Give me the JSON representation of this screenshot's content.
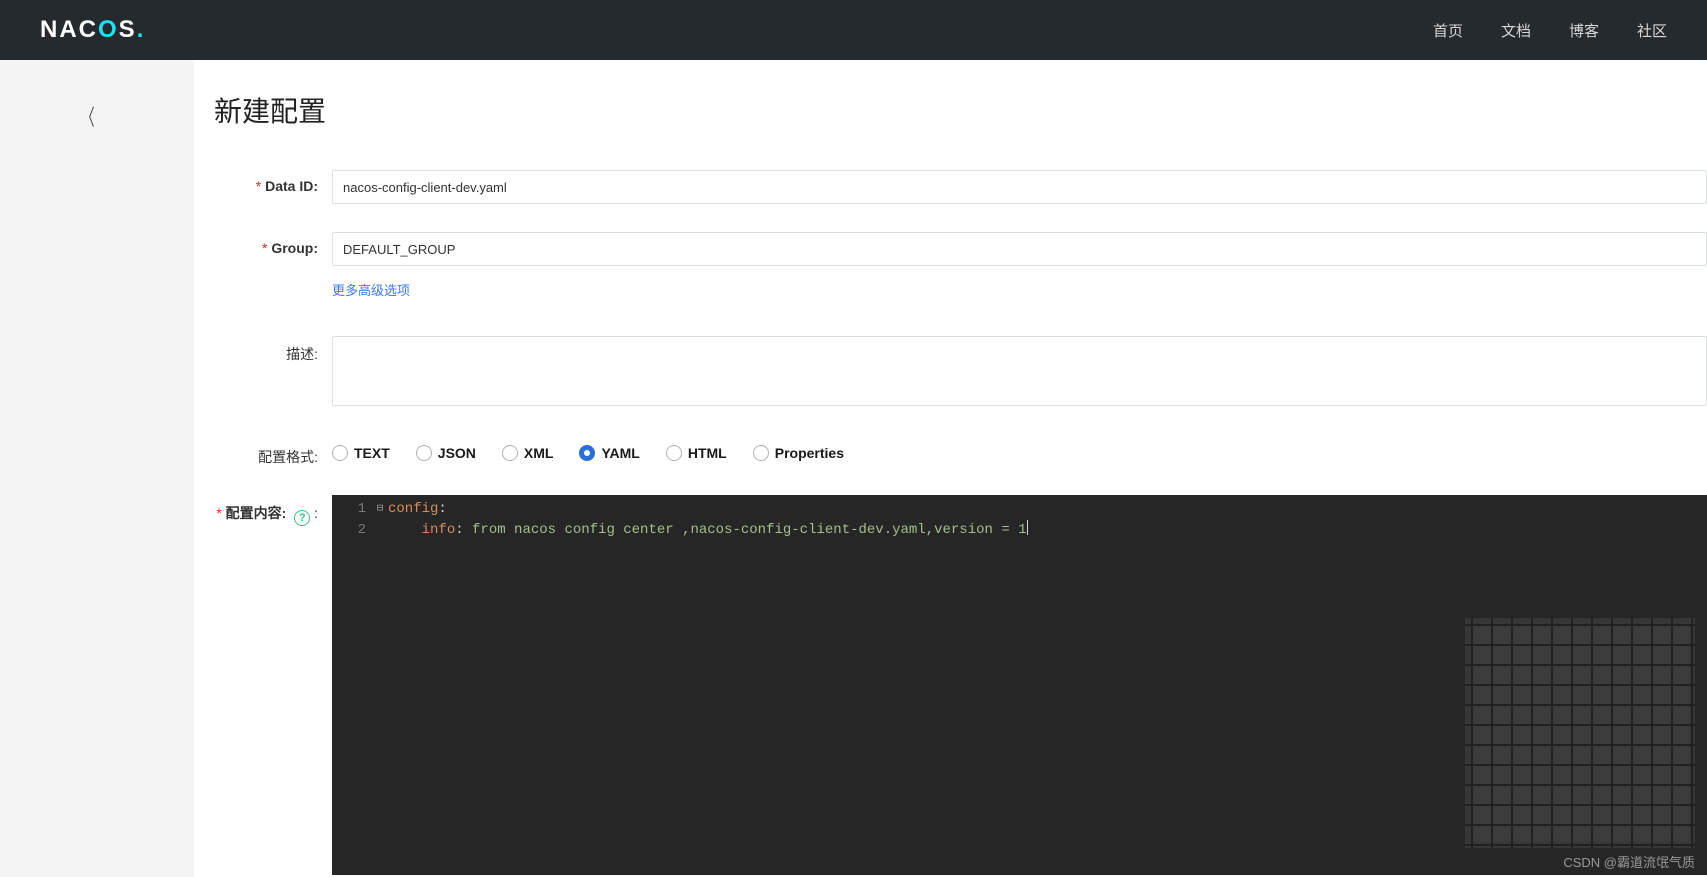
{
  "logo": {
    "prefix": "NAC",
    "accent": "O",
    "suffix": "S",
    "dot": "."
  },
  "nav": {
    "home": "首页",
    "docs": "文档",
    "blog": "博客",
    "community": "社区"
  },
  "page": {
    "title": "新建配置"
  },
  "form": {
    "data_id_label": "Data ID:",
    "data_id_value": "nacos-config-client-dev.yaml",
    "group_label": "Group:",
    "group_value": "DEFAULT_GROUP",
    "more_options": "更多高级选项",
    "description_label": "描述:",
    "description_value": "",
    "format_label": "配置格式:",
    "content_label": "配置内容:",
    "help_mark": "?"
  },
  "formats": {
    "text": "TEXT",
    "json": "JSON",
    "xml": "XML",
    "yaml": "YAML",
    "html": "HTML",
    "properties": "Properties",
    "selected": "YAML"
  },
  "editor": {
    "line1_num": "1",
    "line2_num": "2",
    "fold1": "⊟",
    "line1_key": "config",
    "line1_sep": ":",
    "line2_indent": "    ",
    "line2_key": "info",
    "line2_sep": ": ",
    "line2_value": "from nacos config center ,nacos-config-client-dev.yaml,version = 1"
  },
  "watermark": "CSDN @霸道流氓气质"
}
